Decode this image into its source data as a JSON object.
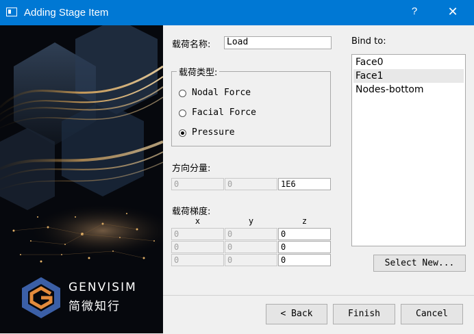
{
  "window": {
    "title": "Adding Stage Item",
    "help": "?",
    "close": "✕"
  },
  "brand": {
    "name": "GENVISIM",
    "sub": "简微知行"
  },
  "load_name": {
    "label": "载荷名称:",
    "value": "Load"
  },
  "load_type": {
    "label": "载荷类型:",
    "options": [
      "Nodal Force",
      "Facial Force",
      "Pressure"
    ],
    "selected": "Pressure"
  },
  "direction": {
    "label": "方向分量:",
    "values": [
      "0",
      "0",
      "1E6"
    ]
  },
  "gradient": {
    "label": "载荷梯度:",
    "columns": [
      "x",
      "y",
      "z"
    ],
    "rows": [
      [
        "0",
        "0",
        "0"
      ],
      [
        "0",
        "0",
        "0"
      ],
      [
        "0",
        "0",
        "0"
      ]
    ]
  },
  "bind": {
    "label": "Bind to:",
    "items": [
      "Face0",
      "Face1",
      "Nodes-bottom"
    ],
    "selected": "Face1"
  },
  "buttons": {
    "select_new": "Select New...",
    "back": "< Back",
    "finish": "Finish",
    "cancel": "Cancel"
  }
}
